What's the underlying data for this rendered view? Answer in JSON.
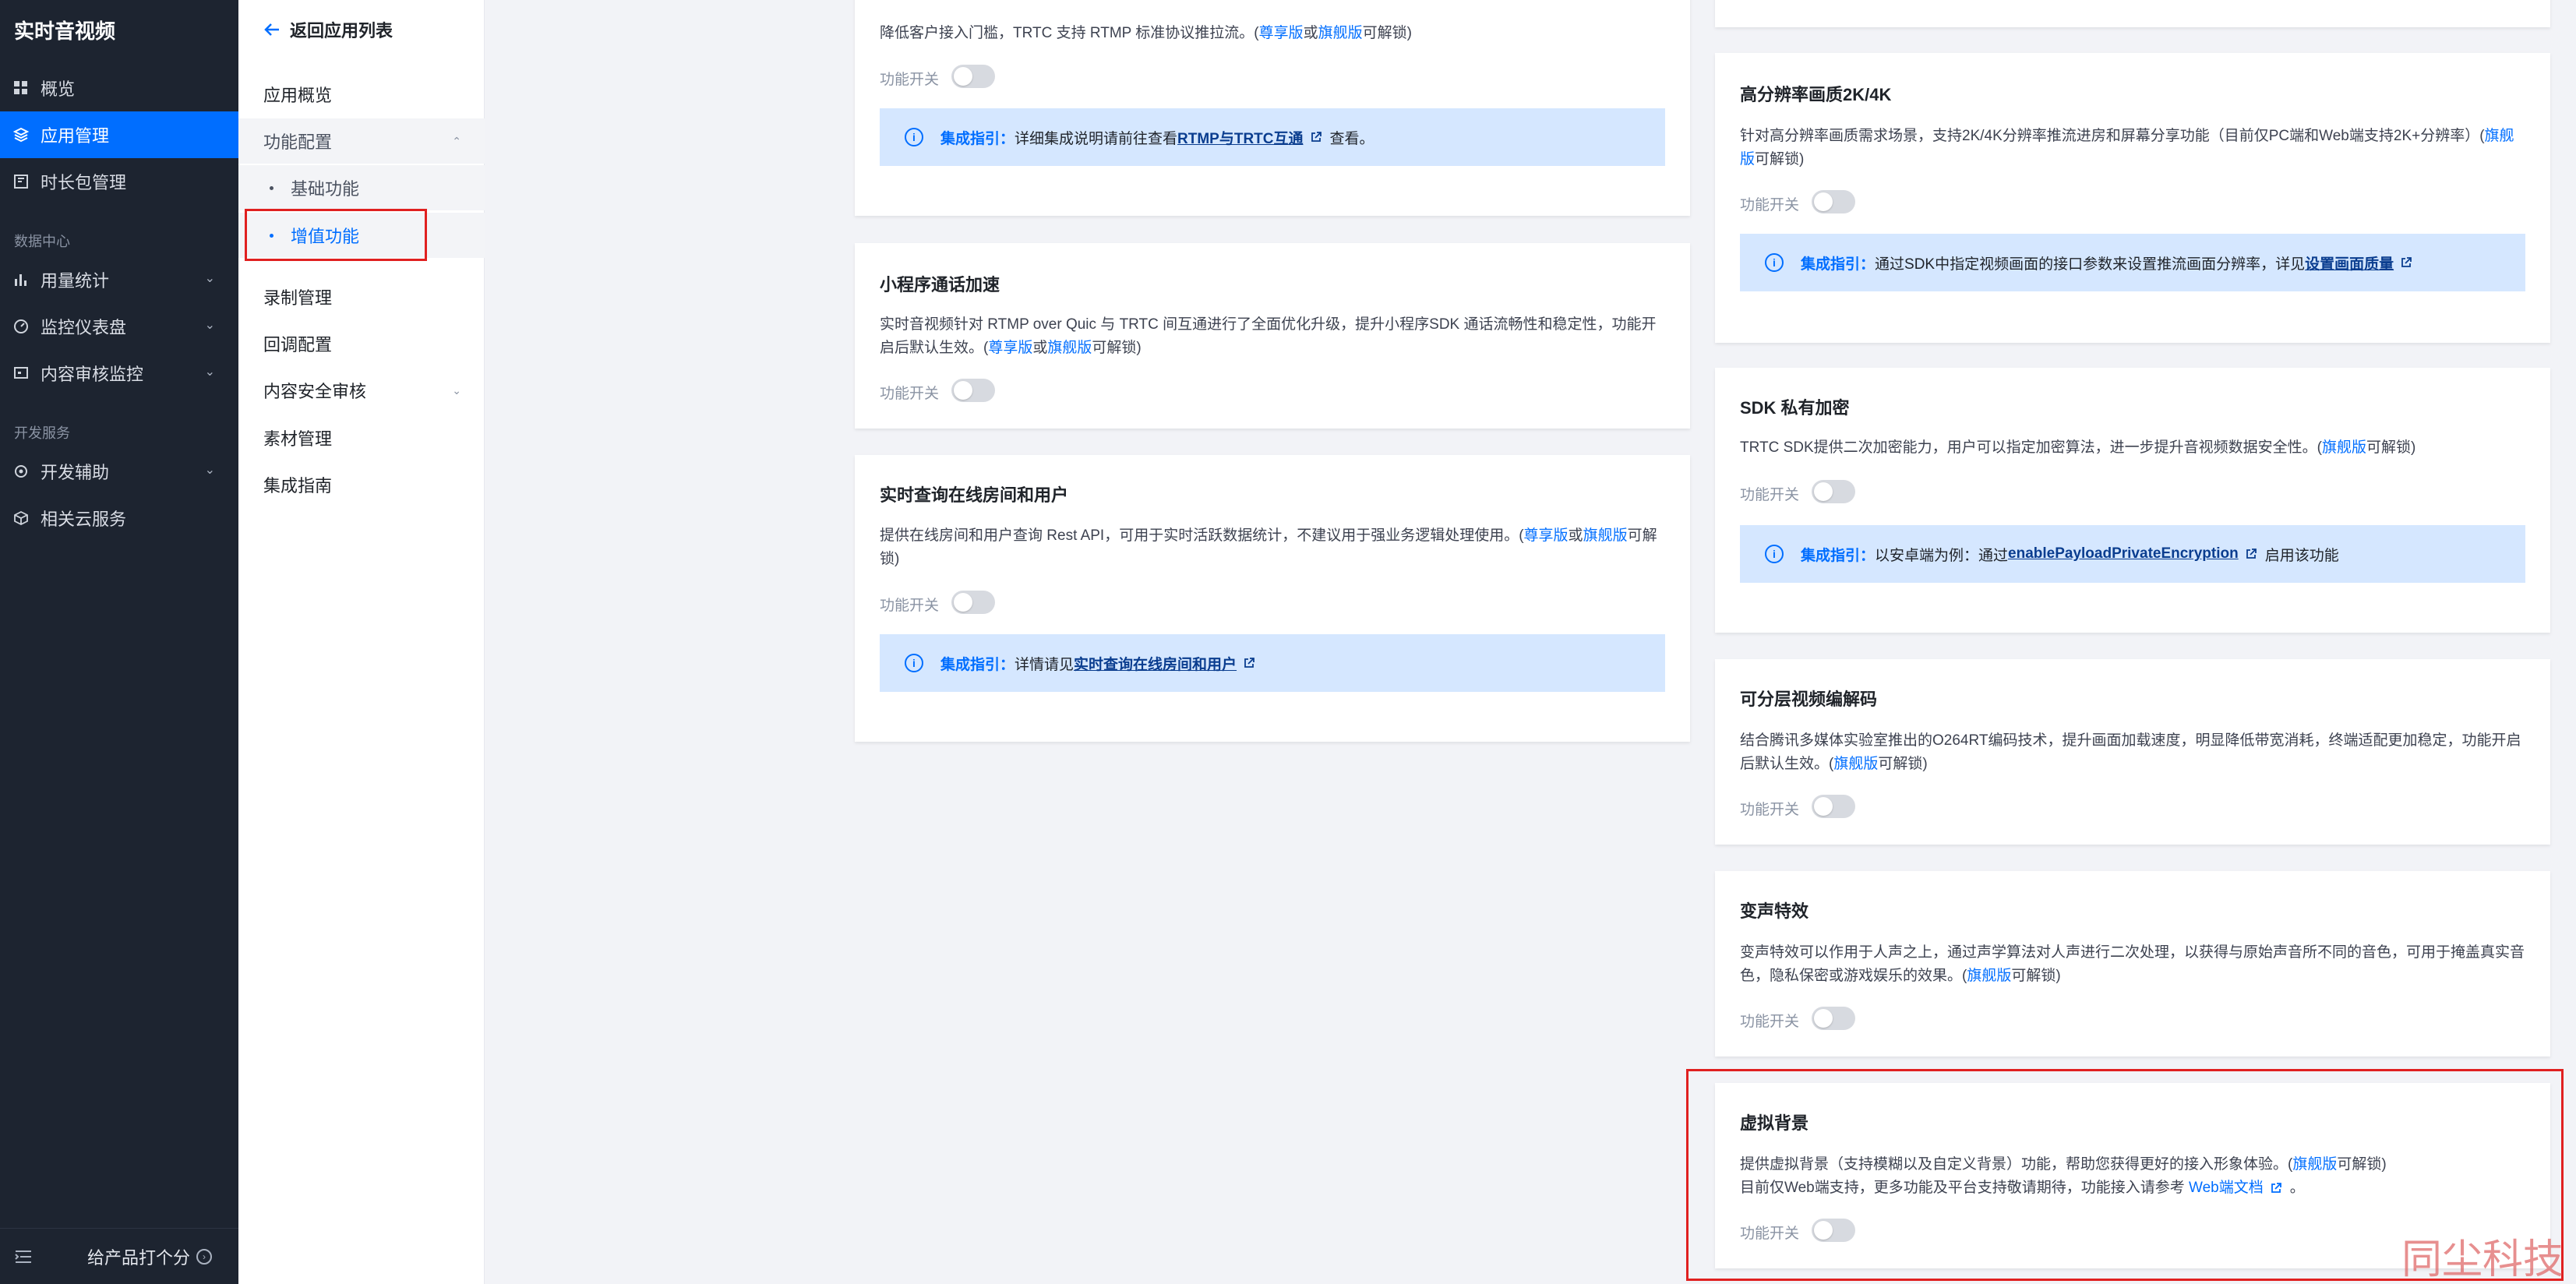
{
  "nav": {
    "title": "实时音视频",
    "items": [
      {
        "label": "概览"
      },
      {
        "label": "应用管理"
      },
      {
        "label": "时长包管理"
      },
      {
        "label": "用量统计"
      },
      {
        "label": "监控仪表盘"
      },
      {
        "label": "内容审核监控"
      },
      {
        "label": "开发辅助"
      },
      {
        "label": "相关云服务"
      }
    ],
    "section_data": "数据中心",
    "section_dev": "开发服务",
    "footer": "给产品打个分"
  },
  "subnav": {
    "back": "返回应用列表",
    "items": [
      {
        "label": "应用概览"
      },
      {
        "label": "功能配置"
      },
      {
        "label": "基础功能"
      },
      {
        "label": "增值功能"
      },
      {
        "label": "录制管理"
      },
      {
        "label": "回调配置"
      },
      {
        "label": "内容安全审核"
      },
      {
        "label": "素材管理"
      },
      {
        "label": "集成指南"
      }
    ]
  },
  "common": {
    "switch_label": "功能开关",
    "tip_prefix": "集成指引：",
    "premium": "尊享版",
    "or": "或",
    "flagship": "旗舰版",
    "unlock": "可解锁)",
    "colors": {
      "accent": "#006eff",
      "sidebar": "#1d2430",
      "tip_bg": "#d5e7ff",
      "highlight": "#e02020"
    }
  },
  "left_cards": {
    "rtmp": {
      "desc_a": "降低客户接入门槛，TRTC 支持 RTMP 标准协议推拉流。(",
      "tip_a": "详细集成说明请前往查看 ",
      "tip_link": "RTMP与TRTC互通",
      "tip_b": "查看。"
    },
    "miniprogram": {
      "title": "小程序通话加速",
      "desc_a": "实时音视频针对 RTMP over Quic 与 TRTC 间互通进行了全面优化升级，提升小程序SDK 通话流畅性和稳定性，功能开启后默认生效。("
    },
    "rooms": {
      "title": "实时查询在线房间和用户",
      "desc_a": "提供在线房间和用户查询 Rest API，可用于实时活跃数据统计，不建议用于强业务逻辑处理使用。(",
      "tip_a": "详情请见 ",
      "tip_link": "实时查询在线房间和用户"
    }
  },
  "right_cards": {
    "hd": {
      "title": "高分辨率画质2K/4K",
      "desc_a": "针对高分辨率画质需求场景，支持2K/4K分辨率推流进房和屏幕分享功能（目前仅PC端和Web端支持2K+分辨率）(",
      "tip_a": "通过SDK中指定视频画面的接口参数来设置推流画面分辨率，详见 ",
      "tip_link": "设置画面质量"
    },
    "encrypt": {
      "title": "SDK 私有加密",
      "desc_a": "TRTC SDK提供二次加密能力，用户可以指定加密算法，进一步提升音视频数据安全性。(",
      "tip_a": "以安卓端为例：通过 ",
      "tip_link": "enablePayloadPrivateEncryption",
      "tip_b": "启用该功能"
    },
    "layered": {
      "title": "可分层视频编解码",
      "desc_a": "结合腾讯多媒体实验室推出的O264RT编码技术，提升画面加载速度，明显降低带宽消耗，终端适配更加稳定，功能开启后默认生效。("
    },
    "voice": {
      "title": "变声特效",
      "desc_a": "变声特效可以作用于人声之上，通过声学算法对人声进行二次处理，以获得与原始声音所不同的音色，可用于掩盖真实音色，隐私保密或游戏娱乐的效果。("
    },
    "bg": {
      "title": "虚拟背景",
      "desc_a": "提供虚拟背景（支持模糊以及自定义背景）功能，帮助您获得更好的接入形象体验。(",
      "desc_b": "目前仅Web端支持，更多功能及平台支持敬请期待，功能接入请参考 ",
      "desc_link": "Web端文档",
      "desc_c": "。"
    }
  },
  "watermark": "同尘科技"
}
